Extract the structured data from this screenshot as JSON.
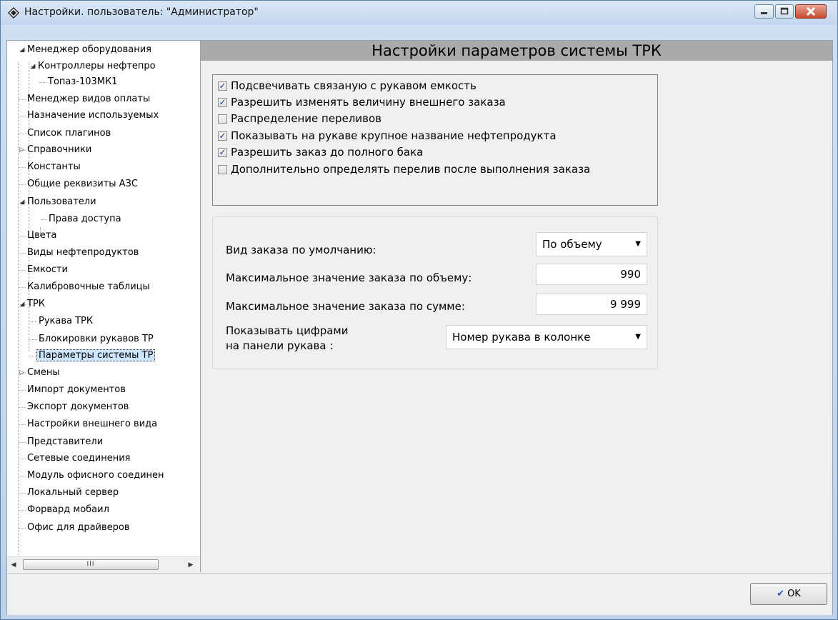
{
  "window": {
    "title": "Настройки. пользователь: \"Администратор\""
  },
  "tree": {
    "items": [
      {
        "label": "Менеджер оборудования",
        "expander": "◢"
      },
      {
        "label": "Контроллеры нефтепро",
        "expander": "◢"
      },
      {
        "label": "Топаз-103МК1"
      },
      {
        "label": "Менеджер видов оплаты"
      },
      {
        "label": "Назначение используемых"
      },
      {
        "label": "Список плагинов"
      },
      {
        "label": "Справочники",
        "expander": "▷"
      },
      {
        "label": "Константы"
      },
      {
        "label": "Общие реквизиты АЗС"
      },
      {
        "label": "Пользователи",
        "expander": "◢"
      },
      {
        "label": "Права доступа"
      },
      {
        "label": "Цвета"
      },
      {
        "label": "Виды нефтепродуктов"
      },
      {
        "label": "Емкости"
      },
      {
        "label": "Калибровочные таблицы"
      },
      {
        "label": "ТРК",
        "expander": "◢"
      },
      {
        "label": "Рукава ТРК"
      },
      {
        "label": "Блокировки рукавов ТР"
      },
      {
        "label": "Параметры системы ТР"
      },
      {
        "label": "Смены",
        "expander": "▷"
      },
      {
        "label": "Импорт документов"
      },
      {
        "label": "Экспорт документов"
      },
      {
        "label": "Настройки внешнего вида"
      },
      {
        "label": "Представители"
      },
      {
        "label": "Сетевые соединения"
      },
      {
        "label": "Модуль офисного соединен"
      },
      {
        "label": "Локальный сервер"
      },
      {
        "label": "Форвард мобаил"
      },
      {
        "label": "Офис для драйверов"
      }
    ],
    "scroll_grip": "III"
  },
  "panel": {
    "title": "Настройки параметров системы ТРК",
    "checkboxes": [
      {
        "label": "Подсвечивать связаную с рукавом емкость",
        "checked": true
      },
      {
        "label": "Разрешить изменять величину внешнего заказа",
        "checked": true
      },
      {
        "label": "Распределение переливов",
        "checked": false
      },
      {
        "label": "Показывать на рукаве крупное название нефтепродукта",
        "checked": true
      },
      {
        "label": "Разрешить заказ до полного бака",
        "checked": true
      },
      {
        "label": "Дополнительно определять перелив после выполнения заказа",
        "checked": false
      }
    ],
    "fields": {
      "order_type_label": "Вид заказа по умолчанию:",
      "order_type_value": "По объему",
      "max_volume_label": "Максимальное значение заказа по объему:",
      "max_volume_value": "990",
      "max_sum_label": "Максимальное значение заказа по сумме:",
      "max_sum_value": "9 999",
      "show_digits_label_1": "Показывать цифрами",
      "show_digits_label_2": "на панели рукава :",
      "show_digits_value": "Номер рукава в колонке"
    }
  },
  "footer": {
    "ok_label": "OK"
  }
}
